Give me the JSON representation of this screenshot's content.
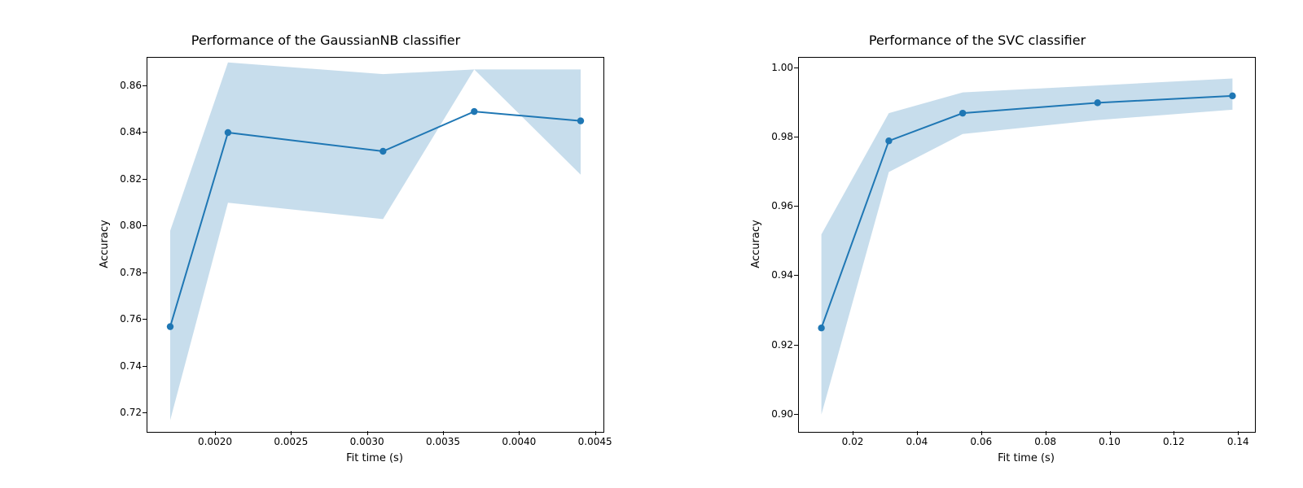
{
  "chart_data": [
    {
      "type": "line",
      "title": "Performance of the GaussianNB classifier",
      "xlabel": "Fit time (s)",
      "ylabel": "Accuracy",
      "xlim": [
        0.00155,
        0.00455
      ],
      "ylim": [
        0.712,
        0.872
      ],
      "xticks": [
        0.002,
        0.0025,
        0.003,
        0.0035,
        0.004,
        0.0045
      ],
      "xtick_labels": [
        "0.0020",
        "0.0025",
        "0.0030",
        "0.0035",
        "0.0040",
        "0.0045"
      ],
      "yticks": [
        0.72,
        0.74,
        0.76,
        0.78,
        0.8,
        0.82,
        0.84,
        0.86
      ],
      "ytick_labels": [
        "0.72",
        "0.74",
        "0.76",
        "0.78",
        "0.80",
        "0.82",
        "0.84",
        "0.86"
      ],
      "series": {
        "x": [
          0.0017,
          0.00208,
          0.0031,
          0.0037,
          0.0044
        ],
        "y": [
          0.757,
          0.84,
          0.832,
          0.849,
          0.845
        ],
        "lower": [
          0.717,
          0.81,
          0.803,
          0.867,
          0.822
        ],
        "upper": [
          0.798,
          0.87,
          0.865,
          0.867,
          0.867
        ]
      }
    },
    {
      "type": "line",
      "title": "Performance of the SVC classifier",
      "xlabel": "Fit time (s)",
      "ylabel": "Accuracy",
      "xlim": [
        0.003,
        0.145
      ],
      "ylim": [
        0.895,
        1.003
      ],
      "xticks": [
        0.02,
        0.04,
        0.06,
        0.08,
        0.1,
        0.12,
        0.14
      ],
      "xtick_labels": [
        "0.02",
        "0.04",
        "0.06",
        "0.08",
        "0.10",
        "0.12",
        "0.14"
      ],
      "yticks": [
        0.9,
        0.92,
        0.94,
        0.96,
        0.98,
        1.0
      ],
      "ytick_labels": [
        "0.90",
        "0.92",
        "0.94",
        "0.96",
        "0.98",
        "1.00"
      ],
      "series": {
        "x": [
          0.01,
          0.031,
          0.054,
          0.096,
          0.138
        ],
        "y": [
          0.925,
          0.979,
          0.987,
          0.99,
          0.992
        ],
        "lower": [
          0.9,
          0.97,
          0.981,
          0.985,
          0.988
        ],
        "upper": [
          0.952,
          0.987,
          0.993,
          0.995,
          0.997
        ]
      }
    }
  ]
}
